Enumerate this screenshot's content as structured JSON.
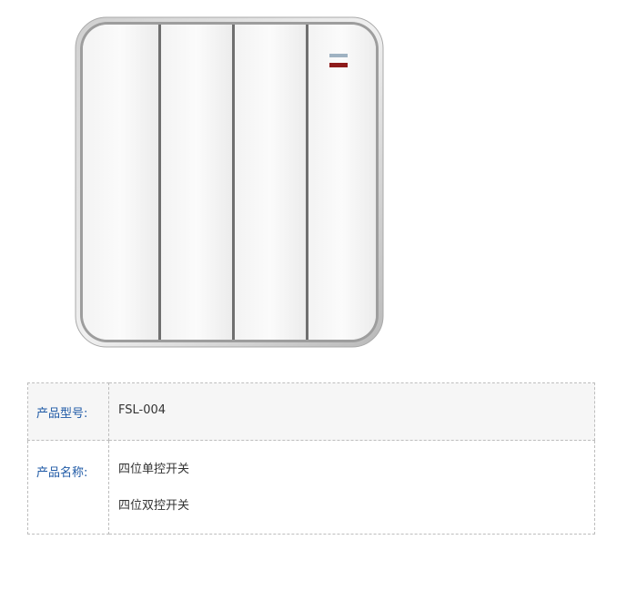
{
  "product": {
    "image_name": "four-gang-wall-switch",
    "indicator_colors": [
      "#9fb2c2",
      "#8e1b1b"
    ]
  },
  "specs": {
    "model_label": "产品型号:",
    "model_value": "FSL-004",
    "name_label": "产品名称:",
    "name_values": [
      "四位单控开关",
      "四位双控开关"
    ]
  }
}
